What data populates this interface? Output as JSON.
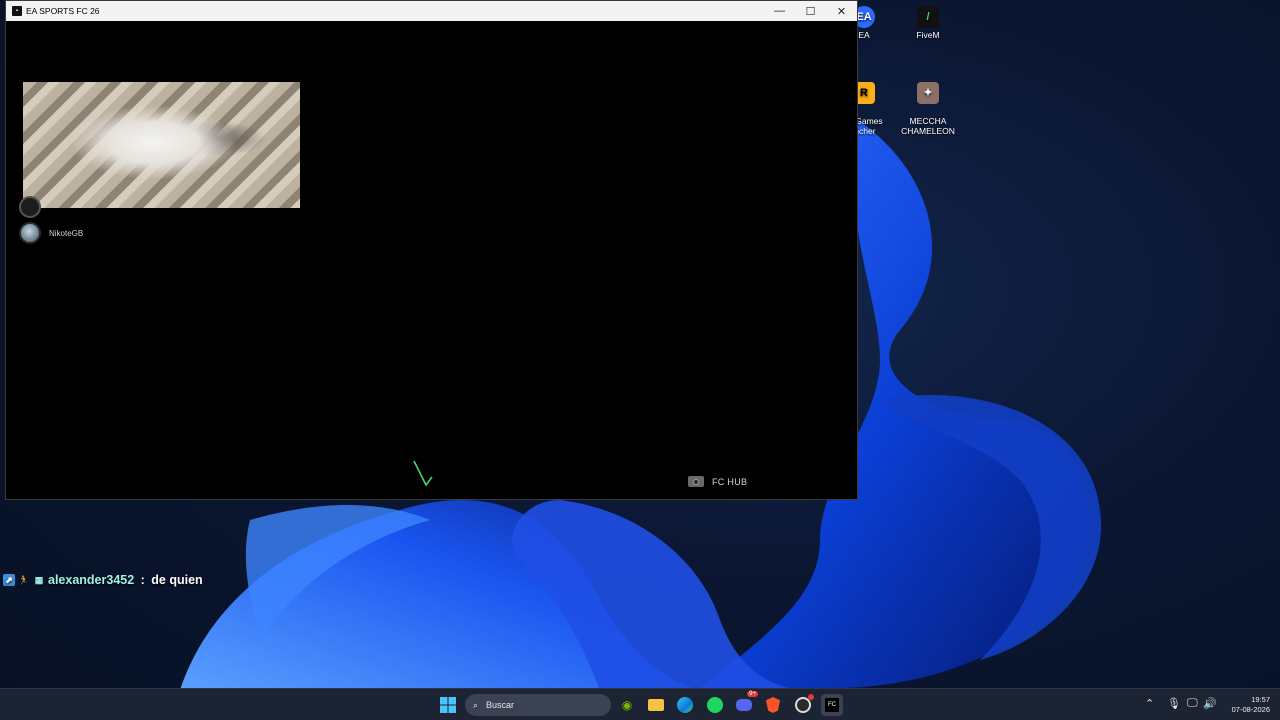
{
  "desktop": {
    "icons": [
      {
        "label": "EA",
        "name": "desktop-icon-ea"
      },
      {
        "label": "FiveM",
        "name": "desktop-icon-fivem"
      },
      {
        "label": "ar Games\nincher",
        "name": "desktop-icon-rockstar"
      },
      {
        "label": "MECCHA\nCHAMELEON",
        "name": "desktop-icon-meccha"
      }
    ]
  },
  "window": {
    "title": "EA SPORTS FC 26",
    "minimize": "—",
    "maximize": "☐",
    "close": "✕",
    "voice_users": [
      "NikoteGB"
    ],
    "hub_label": "FC HUB"
  },
  "chat": {
    "username": "alexander3452",
    "separator": " : ",
    "message": "de quien"
  },
  "taskbar": {
    "search_label": "Buscar",
    "discord_badge": "9+",
    "time": "19:57",
    "date": "07-08-2026"
  },
  "colors": {
    "accent_green": "#4ad66d",
    "chat_username": "#9ff3e6",
    "taskbar_bg": "#1c2433"
  }
}
